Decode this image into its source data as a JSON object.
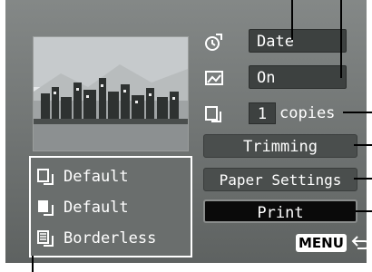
{
  "print_settings": {
    "style_date": "Date",
    "file_no": "On",
    "copies": "1",
    "copies_unit": "copies"
  },
  "buttons": {
    "trimming": "Trimming",
    "paper_settings": "Paper Settings",
    "print": "Print"
  },
  "menu": {
    "label": "MENU",
    "icon": "return-icon"
  },
  "paper_settings_panel": {
    "paper_size": "Default",
    "paper_type": "Default",
    "layout": "Borderless"
  },
  "icons": [
    "style-icon",
    "file-number-icon",
    "copies-icon",
    "paper-size-icon",
    "paper-type-icon",
    "layout-icon"
  ]
}
